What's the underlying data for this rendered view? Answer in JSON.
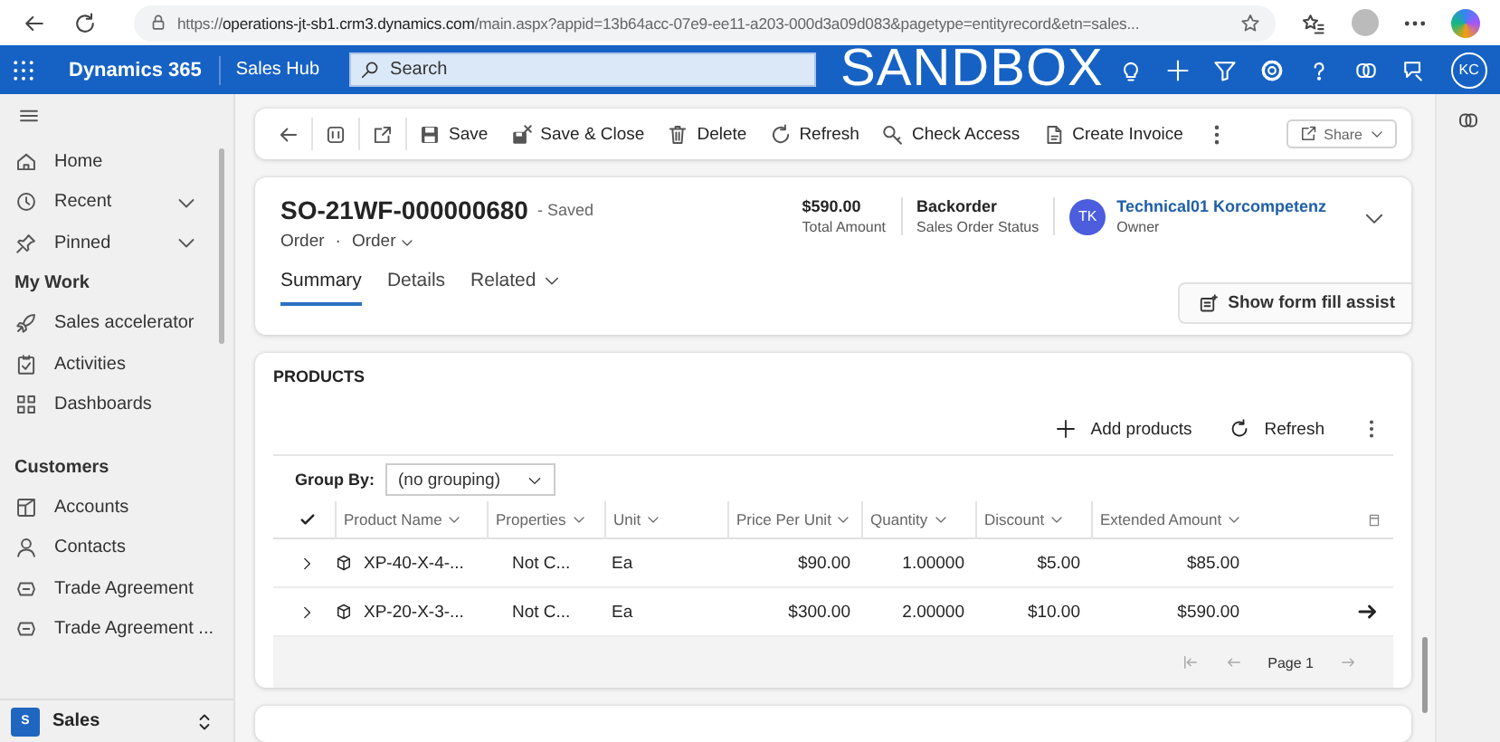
{
  "browser": {
    "url_scheme": "https://",
    "url_host": "operations-jt-sb1.crm3.dynamics.com",
    "url_rest": "/main.aspx?appid=13b64acc-07e9-ee11-a203-000d3a09d083&pagetype=entityrecord&etn=sales..."
  },
  "app_bar": {
    "product": "Dynamics 365",
    "app": "Sales Hub",
    "search_placeholder": "Search",
    "environment": "SANDBOX",
    "user_initials": "KC"
  },
  "sidebar": {
    "items": [
      {
        "label": "Home"
      },
      {
        "label": "Recent",
        "expanded": false
      },
      {
        "label": "Pinned",
        "expanded": false
      }
    ],
    "groups": [
      {
        "title": "My Work",
        "items": [
          {
            "label": "Sales accelerator"
          },
          {
            "label": "Activities"
          },
          {
            "label": "Dashboards"
          }
        ]
      },
      {
        "title": "Customers",
        "items": [
          {
            "label": "Accounts"
          },
          {
            "label": "Contacts"
          },
          {
            "label": "Trade Agreement"
          },
          {
            "label": "Trade Agreement ..."
          }
        ]
      }
    ],
    "area": {
      "badge": "S",
      "label": "Sales"
    }
  },
  "command_bar": {
    "buttons": [
      "Save",
      "Save & Close",
      "Delete",
      "Refresh",
      "Check Access",
      "Create Invoice"
    ],
    "share": "Share"
  },
  "header": {
    "title": "SO-21WF-000000680",
    "save_status": "- Saved",
    "entity": "Order",
    "separator": "·",
    "form": "Order",
    "fields": [
      {
        "value": "$590.00",
        "label": "Total Amount"
      },
      {
        "value": "Backorder",
        "label": "Sales Order Status"
      }
    ],
    "owner": {
      "initials": "TK",
      "name": "Technical01 Korcompetenz",
      "label": "Owner"
    },
    "tabs": [
      {
        "label": "Summary",
        "selected": true,
        "menu": false
      },
      {
        "label": "Details",
        "selected": false,
        "menu": false
      },
      {
        "label": "Related",
        "selected": false,
        "menu": true
      }
    ],
    "assist_button": "Show form fill assist"
  },
  "products": {
    "title": "PRODUCTS",
    "actions": [
      "Add products",
      "Refresh"
    ],
    "group_by": {
      "label": "Group By:",
      "value": "(no grouping)"
    },
    "table": {
      "select_all_checked": true,
      "columns": [
        "Product Name",
        "Properties",
        "Unit",
        "Price Per Unit",
        "Quantity",
        "Discount",
        "Extended Amount"
      ],
      "rows": [
        {
          "cells": [
            "XP-40-X-4-...",
            "Not C...",
            "Ea",
            "$90.00",
            "1.00000",
            "$5.00",
            "$85.00"
          ],
          "hovered": false
        },
        {
          "cells": [
            "XP-20-X-3-...",
            "Not C...",
            "Ea",
            "$300.00",
            "2.00000",
            "$10.00",
            "$590.00"
          ],
          "hovered": true
        }
      ]
    },
    "pager": "Page 1"
  }
}
